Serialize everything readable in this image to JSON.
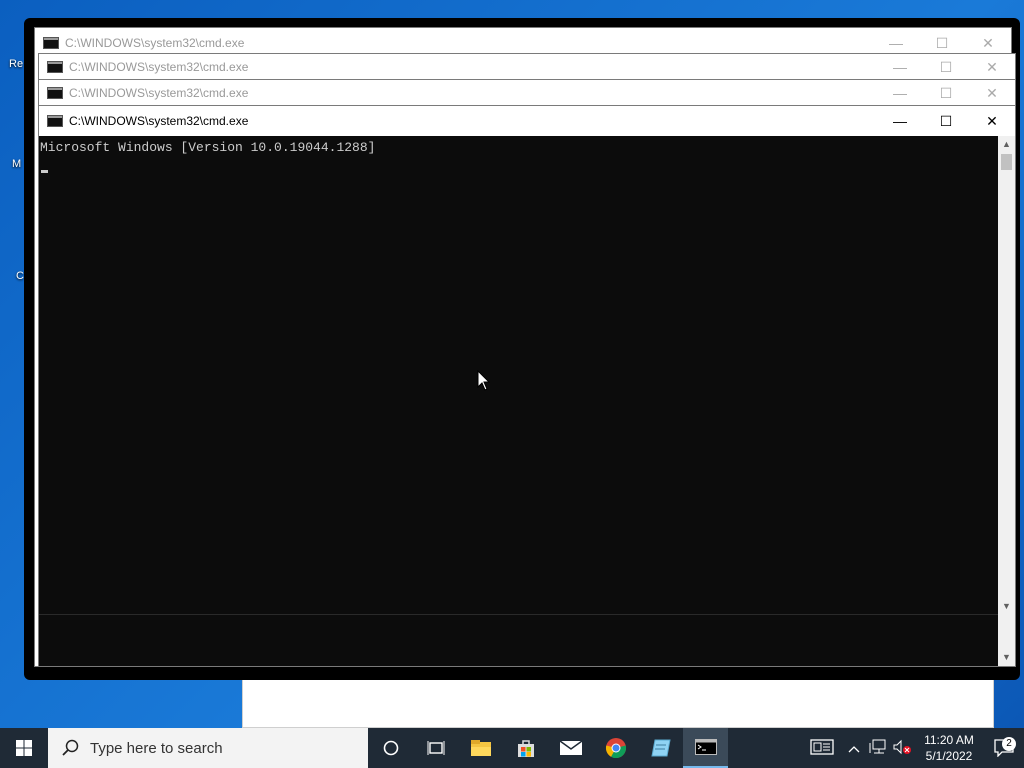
{
  "desktop": {
    "icons": [
      {
        "label": "Re"
      },
      {
        "label": "M"
      },
      {
        "label": "C"
      }
    ]
  },
  "windows": [
    {
      "title": "C:\\WINDOWS\\system32\\cmd.exe"
    },
    {
      "title": "C:\\WINDOWS\\system32\\cmd.exe"
    },
    {
      "title": "C:\\WINDOWS\\system32\\cmd.exe"
    },
    {
      "title": "C:\\WINDOWS\\system32\\cmd.exe"
    }
  ],
  "console": {
    "lines": [
      "Microsoft Windows [Version 10.0.19044.1288]"
    ]
  },
  "window_controls": {
    "minimize": "—",
    "maximize": "☐",
    "close": "✕"
  },
  "taskbar": {
    "search_placeholder": "Type here to search",
    "clock_time": "11:20 AM",
    "clock_date": "5/1/2022",
    "notification_count": "2",
    "icons": [
      "cortana-icon",
      "task-view-icon",
      "file-explorer-icon",
      "store-icon",
      "mail-icon",
      "chrome-icon",
      "notepad-icon",
      "cmd-icon"
    ]
  },
  "colors": {
    "desktop": "#0a64c8",
    "console_bg": "#0c0c0c",
    "console_fg": "#cccccc",
    "taskbar": "#1f2a36"
  }
}
